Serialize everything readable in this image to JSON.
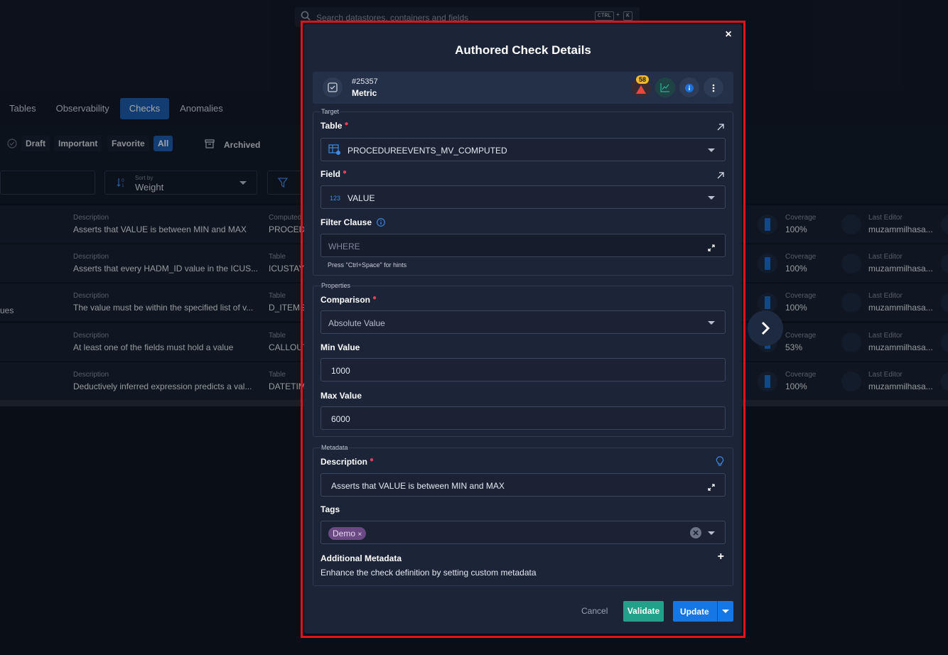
{
  "background": {
    "search_placeholder": "Search datastores, containers and fields",
    "search_shortcut": [
      "CTRL",
      "+",
      "K"
    ],
    "tabs": [
      "Tables",
      "Observability",
      "Checks",
      "Anomalies"
    ],
    "active_tab": "Checks",
    "status_filters": [
      "Draft",
      "Important",
      "Favorite",
      "All"
    ],
    "archived_label": "Archived",
    "sort_label": "Sort by",
    "sort_value": "Weight",
    "partial_left_text": "ues",
    "rows": [
      {
        "desc_label": "Description",
        "desc": "Asserts that VALUE is between MIN and MAX",
        "table_label": "Computed",
        "table": "PROCEDU",
        "cov_label": "Coverage",
        "cov": "100%",
        "editor_label": "Last Editor",
        "editor": "muzammilhasa..."
      },
      {
        "desc_label": "Description",
        "desc": "Asserts that every HADM_ID value in the ICUS...",
        "table_label": "Table",
        "table": "ICUSTAY",
        "cov_label": "Coverage",
        "cov": "100%",
        "editor_label": "Last Editor",
        "editor": "muzammilhasa..."
      },
      {
        "desc_label": "Description",
        "desc": "The value must be within the specified list of v...",
        "table_label": "Table",
        "table": "D_ITEMS",
        "cov_label": "Coverage",
        "cov": "100%",
        "editor_label": "Last Editor",
        "editor": "muzammilhasa..."
      },
      {
        "desc_label": "Description",
        "desc": "At least one of the fields must hold a value",
        "table_label": "Table",
        "table": "CALLOUT",
        "cov_label": "Coverage",
        "cov": "53%",
        "editor_label": "Last Editor",
        "editor": "muzammilhasa..."
      },
      {
        "desc_label": "Description",
        "desc": "Deductively inferred expression predicts a val...",
        "table_label": "Table",
        "table": "DATETIM",
        "cov_label": "Coverage",
        "cov": "100%",
        "editor_label": "Last Editor",
        "editor": "muzammilhasa..."
      }
    ]
  },
  "modal": {
    "title": "Authored Check Details",
    "close_label": "×",
    "check_id": "#25357",
    "check_type": "Metric",
    "anomaly_count": "58",
    "target": {
      "legend": "Target",
      "table_label": "Table",
      "table_value": "PROCEDUREEVENTS_MV_COMPUTED",
      "field_label": "Field",
      "field_value": "VALUE",
      "field_type_badge": "123",
      "filter_label": "Filter Clause",
      "filter_placeholder": "WHERE",
      "filter_hint": "Press \"Ctrl+Space\" for hints"
    },
    "properties": {
      "legend": "Properties",
      "comparison_label": "Comparison",
      "comparison_value": "Absolute Value",
      "min_label": "Min Value",
      "min_value": "1000",
      "max_label": "Max Value",
      "max_value": "6000"
    },
    "metadata": {
      "legend": "Metadata",
      "description_label": "Description",
      "description_value": "Asserts that VALUE is between MIN and MAX",
      "tags_label": "Tags",
      "tags": [
        "Demo"
      ],
      "additional_label": "Additional Metadata",
      "additional_hint": "Enhance the check definition by setting custom metadata",
      "add_symbol": "+"
    },
    "actions": {
      "cancel": "Cancel",
      "validate": "Validate",
      "update": "Update"
    }
  },
  "colors": {
    "accent": "#1576e6",
    "validate": "#21a08a",
    "required": "#e33e5b",
    "highlight_frame": "#e0131a",
    "badge": "#f5b82e"
  }
}
